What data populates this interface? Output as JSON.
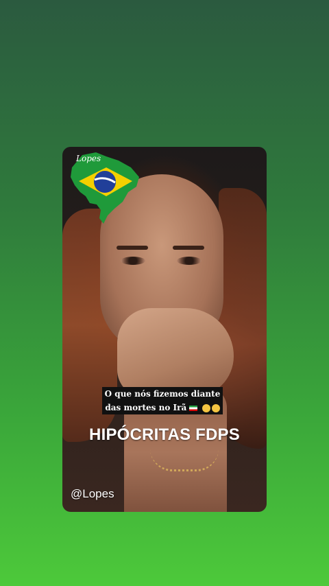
{
  "story": {
    "logo_text": "Lopes",
    "caption_line1": "O que nós fizemos diante",
    "caption_line2": "das mortes no Irã",
    "headline": "HIPÓCRITAS FDPS",
    "handle": "@Lopes"
  },
  "colors": {
    "background_top": "#2b5a3f",
    "background_bottom": "#4dc93a",
    "brazil_green": "#1f9a3a",
    "brazil_yellow": "#f4d000",
    "brazil_blue": "#213f99"
  },
  "icons": [
    "brazil-map-logo-icon",
    "iran-flag-icon",
    "worried-face-icon"
  ]
}
